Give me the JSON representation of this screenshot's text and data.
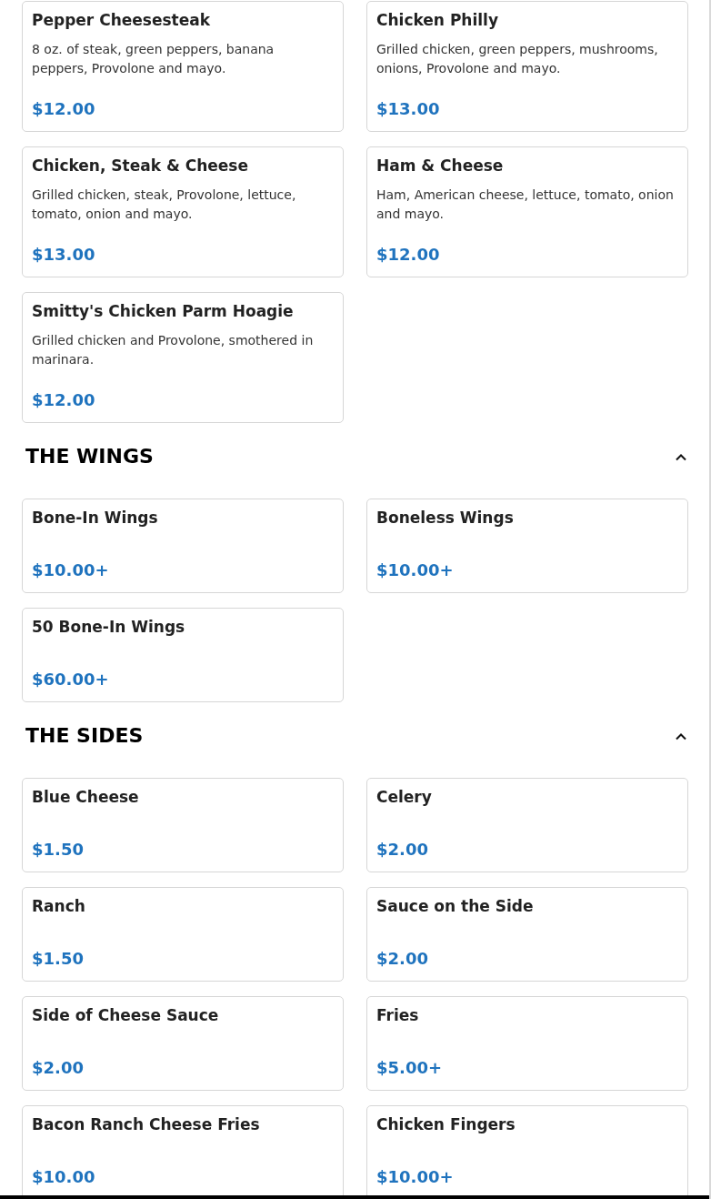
{
  "sections": [
    {
      "items": [
        {
          "name": "Pepper Cheesesteak",
          "description": "8 oz. of steak, green peppers, banana peppers, Provolone and mayo.",
          "price": "$12.00"
        },
        {
          "name": "Chicken Philly",
          "description": "Grilled chicken, green peppers, mushrooms, onions, Provolone and mayo.",
          "price": "$13.00"
        },
        {
          "name": "Chicken, Steak & Cheese",
          "description": "Grilled chicken, steak, Provolone, lettuce, tomato, onion and mayo.",
          "price": "$13.00"
        },
        {
          "name": "Ham & Cheese",
          "description": "Ham, American cheese, lettuce, tomato, onion and mayo.",
          "price": "$12.00"
        },
        {
          "name": "Smitty's Chicken Parm Hoagie",
          "description": "Grilled chicken and Provolone, smothered in marinara.",
          "price": "$12.00"
        }
      ]
    },
    {
      "title": "THE WINGS",
      "expanded": true,
      "items": [
        {
          "name": "Bone-In Wings",
          "price": "$10.00+"
        },
        {
          "name": "Boneless Wings",
          "price": "$10.00+"
        },
        {
          "name": "50 Bone-In Wings",
          "price": "$60.00+"
        }
      ]
    },
    {
      "title": "THE SIDES",
      "expanded": true,
      "items": [
        {
          "name": "Blue Cheese",
          "price": "$1.50"
        },
        {
          "name": "Celery",
          "price": "$2.00"
        },
        {
          "name": "Ranch",
          "price": "$1.50"
        },
        {
          "name": "Sauce on the Side",
          "price": "$2.00"
        },
        {
          "name": "Side of Cheese Sauce",
          "price": "$2.00"
        },
        {
          "name": "Fries",
          "price": "$5.00+"
        },
        {
          "name": "Bacon Ranch Cheese Fries",
          "price": "$10.00"
        },
        {
          "name": "Chicken Fingers",
          "price": "$10.00+"
        }
      ]
    }
  ]
}
